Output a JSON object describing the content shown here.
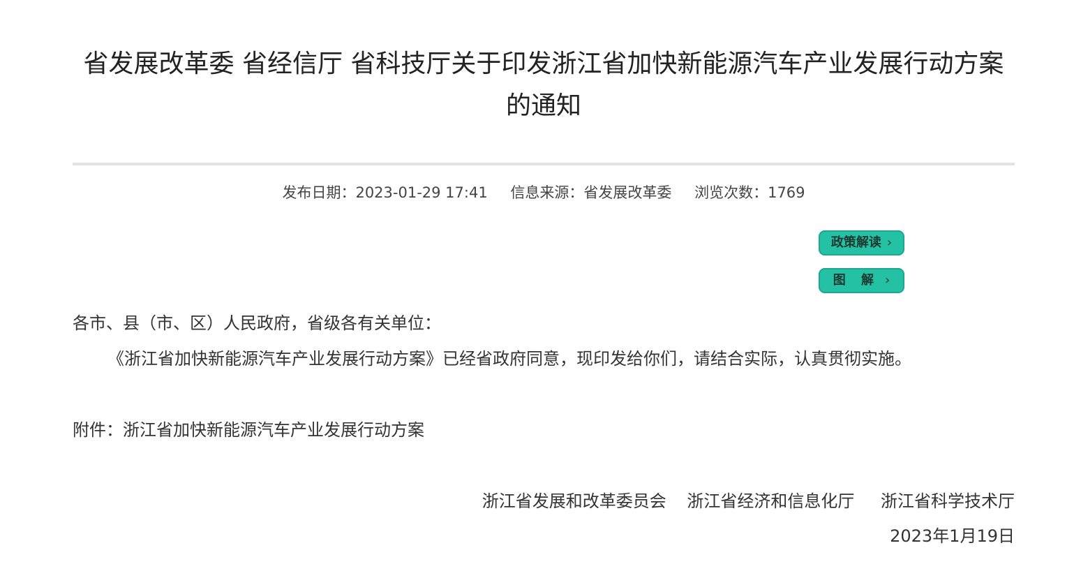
{
  "article": {
    "title": "省发展改革委 省经信厅 省科技厅关于印发浙江省加快新能源汽车产业发展行动方案的通知"
  },
  "meta": {
    "publish_date": "发布日期：2023-01-29 17:41",
    "source": "信息来源：省发展改革委",
    "views": "浏览次数：1769"
  },
  "buttons": {
    "policy_interpretation": "政策解读",
    "illustration": "图 解",
    "chevron": "›"
  },
  "body": {
    "salutation": "各市、县（市、区）人民政府，省级各有关单位：",
    "paragraph": "《浙江省加快新能源汽车产业发展行动方案》已经省政府同意，现印发给你们，请结合实际，认真贯彻实施。",
    "attachment_label": "附件：",
    "attachment_name": "浙江省加快新能源汽车产业发展行动方案"
  },
  "signature": {
    "signers": [
      "浙江省发展和改革委员会",
      "浙江省经济和信息化厅",
      "浙江省科学技术厅"
    ],
    "date": "2023年1月19日"
  },
  "colors": {
    "button_bg": "#24c1a4",
    "divider": "#e2e2e2",
    "text": "#333333"
  }
}
